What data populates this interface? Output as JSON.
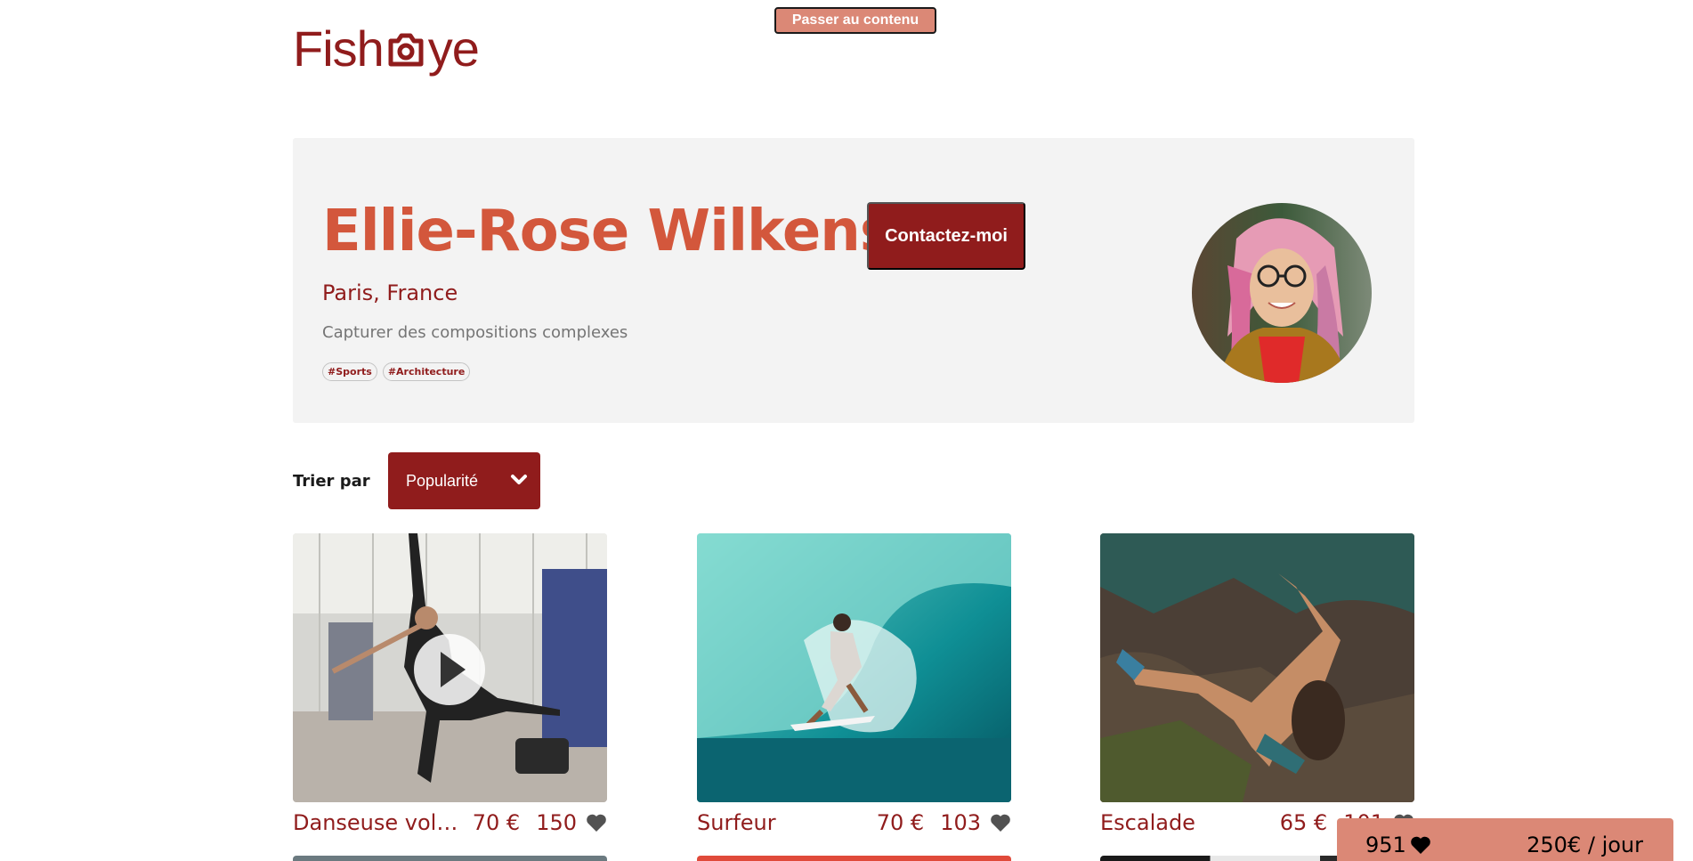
{
  "skip_link": "Passer au contenu",
  "logo": {
    "prefix": "Fish",
    "suffix": "ye",
    "icon": "camera-icon"
  },
  "photographer": {
    "name": "Ellie-Rose Wilkens",
    "location": "Paris, France",
    "tagline": "Capturer des compositions complexes",
    "tags": [
      "#Sports",
      "#Architecture"
    ]
  },
  "contact_button": "Contactez-moi",
  "sort": {
    "label": "Trier par",
    "selected": "Popularité",
    "icon": "chevron-down-icon"
  },
  "media": [
    {
      "title": "Danseuse volante",
      "price": "70 €",
      "likes": "150",
      "type": "video",
      "icon": "play-icon"
    },
    {
      "title": "Surfeur",
      "price": "70 €",
      "likes": "103",
      "type": "image"
    },
    {
      "title": "Escalade",
      "price": "65 €",
      "likes": "101",
      "type": "image"
    }
  ],
  "stats": {
    "total_likes": "951",
    "rate": "250€ / jour",
    "icon": "heart-icon"
  },
  "colors": {
    "primary": "#901c1c",
    "accent": "#d3573c",
    "secondary": "#db8876",
    "card_bg": "#f3f3f3"
  }
}
